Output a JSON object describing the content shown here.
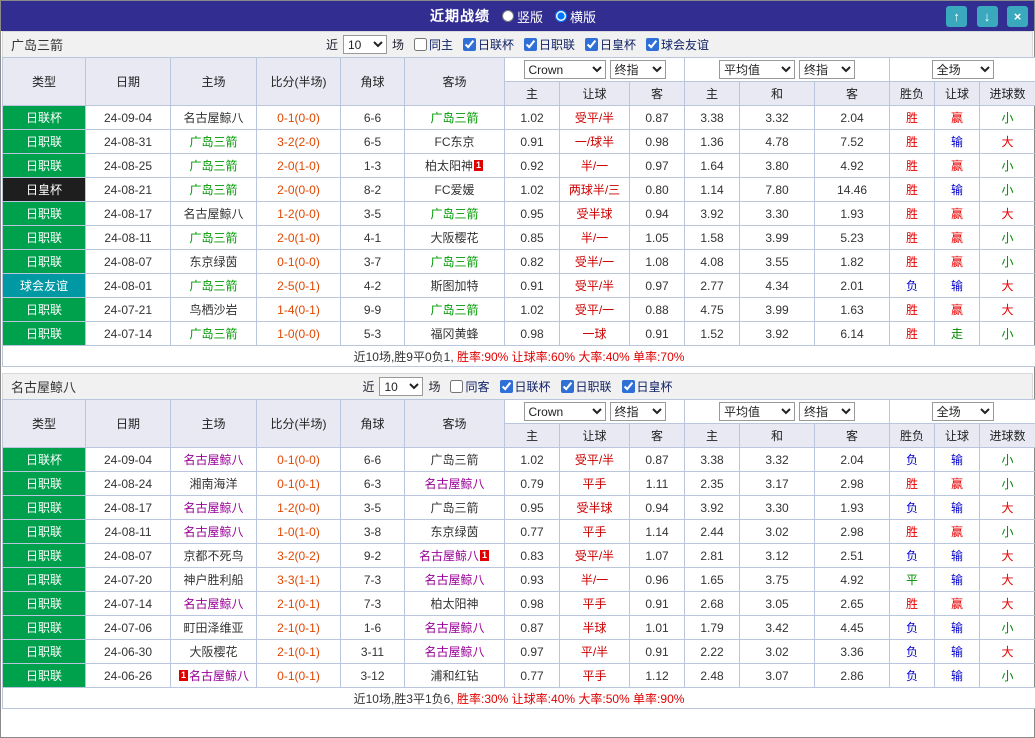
{
  "topbar": {
    "title": "近期战绩",
    "layouts": [
      {
        "label": "竖版",
        "selected": false
      },
      {
        "label": "横版",
        "selected": true
      }
    ],
    "up_icon": "↑",
    "down_icon": "↓",
    "close_icon": "×"
  },
  "filter_labels": {
    "near": "近",
    "count": "10",
    "unit": "场"
  },
  "odds_header": {
    "source": "Crown",
    "final1": "终指",
    "average": "平均值",
    "final2": "终指",
    "scope": "全场"
  },
  "columns": {
    "type": "类型",
    "date": "日期",
    "home": "主场",
    "score": "比分(半场)",
    "corner": "角球",
    "away": "客场",
    "o_home": "主",
    "o_handicap": "让球",
    "o_away": "客",
    "a_home": "主",
    "a_draw": "和",
    "a_away": "客",
    "r_wdl": "胜负",
    "r_handicap": "让球",
    "r_goals": "进球数"
  },
  "card_marker": "1",
  "colors": {
    "win_red": "#e80000",
    "lose_blue": "#0000cc",
    "draw_green": "#008a00",
    "team1_green": "#009900",
    "team2_purple": "#990099",
    "league_green": "#00a14d",
    "cup_dark": "#1e1e1e",
    "friendly_teal": "#0099a3",
    "topbar_indigo": "#322e91",
    "button_teal": "#3aa8bd"
  },
  "sections": [
    {
      "team": "广岛三箭",
      "same_filter": {
        "label": "同主",
        "checked": false
      },
      "league_filters": [
        {
          "label": "日联杯",
          "checked": true
        },
        {
          "label": "日职联",
          "checked": true
        },
        {
          "label": "日皇杯",
          "checked": true
        },
        {
          "label": "球会友谊",
          "checked": true
        }
      ],
      "rows": [
        {
          "lg": "日联杯",
          "lgc": "green",
          "date": "24-09-04",
          "home": "名古屋鲸八",
          "homec": "",
          "score": "0-1(0-0)",
          "corner": "6-6",
          "away": "广岛三箭",
          "awayc": "t1",
          "o": [
            "1.02",
            "受平/半",
            "0.87"
          ],
          "avg": [
            "3.38",
            "3.32",
            "2.04"
          ],
          "res": [
            [
              "胜",
              "w"
            ],
            [
              "赢",
              "w"
            ],
            [
              "小",
              "d"
            ]
          ]
        },
        {
          "lg": "日职联",
          "lgc": "green",
          "date": "24-08-31",
          "home": "广岛三箭",
          "homec": "t1",
          "score": "3-2(2-0)",
          "corner": "6-5",
          "away": "FC东京",
          "awayc": "",
          "o": [
            "0.91",
            "一/球半",
            "0.98"
          ],
          "avg": [
            "1.36",
            "4.78",
            "7.52"
          ],
          "res": [
            [
              "胜",
              "w"
            ],
            [
              "输",
              "l"
            ],
            [
              "大",
              "w"
            ]
          ]
        },
        {
          "lg": "日职联",
          "lgc": "green",
          "date": "24-08-25",
          "home": "广岛三箭",
          "homec": "t1",
          "score": "2-0(1-0)",
          "corner": "1-3",
          "away": "柏太阳神",
          "awayc": "",
          "awaycard": "post",
          "o": [
            "0.92",
            "半/一",
            "0.97"
          ],
          "avg": [
            "1.64",
            "3.80",
            "4.92"
          ],
          "res": [
            [
              "胜",
              "w"
            ],
            [
              "赢",
              "w"
            ],
            [
              "小",
              "d"
            ]
          ]
        },
        {
          "lg": "日皇杯",
          "lgc": "dark",
          "date": "24-08-21",
          "home": "广岛三箭",
          "homec": "t1",
          "score": "2-0(0-0)",
          "corner": "8-2",
          "away": "FC爱媛",
          "awayc": "",
          "o": [
            "1.02",
            "两球半/三",
            "0.80"
          ],
          "avg": [
            "1.14",
            "7.80",
            "14.46"
          ],
          "res": [
            [
              "胜",
              "w"
            ],
            [
              "输",
              "l"
            ],
            [
              "小",
              "d"
            ]
          ]
        },
        {
          "lg": "日职联",
          "lgc": "green",
          "date": "24-08-17",
          "home": "名古屋鲸八",
          "homec": "",
          "score": "1-2(0-0)",
          "corner": "3-5",
          "away": "广岛三箭",
          "awayc": "t1",
          "o": [
            "0.95",
            "受半球",
            "0.94"
          ],
          "avg": [
            "3.92",
            "3.30",
            "1.93"
          ],
          "res": [
            [
              "胜",
              "w"
            ],
            [
              "赢",
              "w"
            ],
            [
              "大",
              "w"
            ]
          ]
        },
        {
          "lg": "日职联",
          "lgc": "green",
          "date": "24-08-11",
          "home": "广岛三箭",
          "homec": "t1",
          "score": "2-0(1-0)",
          "corner": "4-1",
          "away": "大阪樱花",
          "awayc": "",
          "o": [
            "0.85",
            "半/一",
            "1.05"
          ],
          "avg": [
            "1.58",
            "3.99",
            "5.23"
          ],
          "res": [
            [
              "胜",
              "w"
            ],
            [
              "赢",
              "w"
            ],
            [
              "小",
              "d"
            ]
          ]
        },
        {
          "lg": "日职联",
          "lgc": "green",
          "date": "24-08-07",
          "home": "东京绿茵",
          "homec": "",
          "score": "0-1(0-0)",
          "corner": "3-7",
          "away": "广岛三箭",
          "awayc": "t1",
          "o": [
            "0.82",
            "受半/一",
            "1.08"
          ],
          "avg": [
            "4.08",
            "3.55",
            "1.82"
          ],
          "res": [
            [
              "胜",
              "w"
            ],
            [
              "赢",
              "w"
            ],
            [
              "小",
              "d"
            ]
          ]
        },
        {
          "lg": "球会友谊",
          "lgc": "teal",
          "date": "24-08-01",
          "home": "广岛三箭",
          "homec": "t1",
          "score": "2-5(0-1)",
          "corner": "4-2",
          "away": "斯图加特",
          "awayc": "",
          "o": [
            "0.91",
            "受平/半",
            "0.97"
          ],
          "avg": [
            "2.77",
            "4.34",
            "2.01"
          ],
          "res": [
            [
              "负",
              "l"
            ],
            [
              "输",
              "l"
            ],
            [
              "大",
              "w"
            ]
          ]
        },
        {
          "lg": "日职联",
          "lgc": "green",
          "date": "24-07-21",
          "home": "鸟栖沙岩",
          "homec": "",
          "score": "1-4(0-1)",
          "corner": "9-9",
          "away": "广岛三箭",
          "awayc": "t1",
          "o": [
            "1.02",
            "受平/一",
            "0.88"
          ],
          "avg": [
            "4.75",
            "3.99",
            "1.63"
          ],
          "res": [
            [
              "胜",
              "w"
            ],
            [
              "赢",
              "w"
            ],
            [
              "大",
              "w"
            ]
          ]
        },
        {
          "lg": "日职联",
          "lgc": "green",
          "date": "24-07-14",
          "home": "广岛三箭",
          "homec": "t1",
          "score": "1-0(0-0)",
          "corner": "5-3",
          "away": "福冈黄蜂",
          "awayc": "",
          "o": [
            "0.98",
            "一球",
            "0.91"
          ],
          "avg": [
            "1.52",
            "3.92",
            "6.14"
          ],
          "res": [
            [
              "胜",
              "w"
            ],
            [
              "走",
              "d"
            ],
            [
              "小",
              "d"
            ]
          ]
        }
      ],
      "summary_prefix": "近10场,胜9平0负1, ",
      "summary_stats": "胜率:90% 让球率:60% 大率:40% 单率:70%"
    },
    {
      "team": "名古屋鲸八",
      "same_filter": {
        "label": "同客",
        "checked": false
      },
      "league_filters": [
        {
          "label": "日联杯",
          "checked": true
        },
        {
          "label": "日职联",
          "checked": true
        },
        {
          "label": "日皇杯",
          "checked": true
        }
      ],
      "rows": [
        {
          "lg": "日联杯",
          "lgc": "green",
          "date": "24-09-04",
          "home": "名古屋鲸八",
          "homec": "t2",
          "score": "0-1(0-0)",
          "corner": "6-6",
          "away": "广岛三箭",
          "awayc": "",
          "o": [
            "1.02",
            "受平/半",
            "0.87"
          ],
          "avg": [
            "3.38",
            "3.32",
            "2.04"
          ],
          "res": [
            [
              "负",
              "l"
            ],
            [
              "输",
              "l"
            ],
            [
              "小",
              "d"
            ]
          ]
        },
        {
          "lg": "日职联",
          "lgc": "green",
          "date": "24-08-24",
          "home": "湘南海洋",
          "homec": "",
          "score": "0-1(0-1)",
          "corner": "6-3",
          "away": "名古屋鲸八",
          "awayc": "t2",
          "o": [
            "0.79",
            "平手",
            "1.11"
          ],
          "avg": [
            "2.35",
            "3.17",
            "2.98"
          ],
          "res": [
            [
              "胜",
              "w"
            ],
            [
              "赢",
              "w"
            ],
            [
              "小",
              "d"
            ]
          ]
        },
        {
          "lg": "日职联",
          "lgc": "green",
          "date": "24-08-17",
          "home": "名古屋鲸八",
          "homec": "t2",
          "score": "1-2(0-0)",
          "corner": "3-5",
          "away": "广岛三箭",
          "awayc": "",
          "o": [
            "0.95",
            "受半球",
            "0.94"
          ],
          "avg": [
            "3.92",
            "3.30",
            "1.93"
          ],
          "res": [
            [
              "负",
              "l"
            ],
            [
              "输",
              "l"
            ],
            [
              "大",
              "w"
            ]
          ]
        },
        {
          "lg": "日职联",
          "lgc": "green",
          "date": "24-08-11",
          "home": "名古屋鲸八",
          "homec": "t2",
          "score": "1-0(1-0)",
          "corner": "3-8",
          "away": "东京绿茵",
          "awayc": "",
          "o": [
            "0.77",
            "平手",
            "1.14"
          ],
          "avg": [
            "2.44",
            "3.02",
            "2.98"
          ],
          "res": [
            [
              "胜",
              "w"
            ],
            [
              "赢",
              "w"
            ],
            [
              "小",
              "d"
            ]
          ]
        },
        {
          "lg": "日职联",
          "lgc": "green",
          "date": "24-08-07",
          "home": "京都不死鸟",
          "homec": "",
          "score": "3-2(0-2)",
          "corner": "9-2",
          "away": "名古屋鲸八",
          "awayc": "t2",
          "awaycard": "post",
          "o": [
            "0.83",
            "受平/半",
            "1.07"
          ],
          "avg": [
            "2.81",
            "3.12",
            "2.51"
          ],
          "res": [
            [
              "负",
              "l"
            ],
            [
              "输",
              "l"
            ],
            [
              "大",
              "w"
            ]
          ]
        },
        {
          "lg": "日职联",
          "lgc": "green",
          "date": "24-07-20",
          "home": "神户胜利船",
          "homec": "",
          "score": "3-3(1-1)",
          "corner": "7-3",
          "away": "名古屋鲸八",
          "awayc": "t2",
          "o": [
            "0.93",
            "半/一",
            "0.96"
          ],
          "avg": [
            "1.65",
            "3.75",
            "4.92"
          ],
          "res": [
            [
              "平",
              "d"
            ],
            [
              "输",
              "l"
            ],
            [
              "大",
              "w"
            ]
          ]
        },
        {
          "lg": "日职联",
          "lgc": "green",
          "date": "24-07-14",
          "home": "名古屋鲸八",
          "homec": "t2",
          "score": "2-1(0-1)",
          "corner": "7-3",
          "away": "柏太阳神",
          "awayc": "",
          "o": [
            "0.98",
            "平手",
            "0.91"
          ],
          "avg": [
            "2.68",
            "3.05",
            "2.65"
          ],
          "res": [
            [
              "胜",
              "w"
            ],
            [
              "赢",
              "w"
            ],
            [
              "大",
              "w"
            ]
          ]
        },
        {
          "lg": "日职联",
          "lgc": "green",
          "date": "24-07-06",
          "home": "町田泽维亚",
          "homec": "",
          "score": "2-1(0-1)",
          "corner": "1-6",
          "away": "名古屋鲸八",
          "awayc": "t2",
          "o": [
            "0.87",
            "半球",
            "1.01"
          ],
          "avg": [
            "1.79",
            "3.42",
            "4.45"
          ],
          "res": [
            [
              "负",
              "l"
            ],
            [
              "输",
              "l"
            ],
            [
              "小",
              "d"
            ]
          ]
        },
        {
          "lg": "日职联",
          "lgc": "green",
          "date": "24-06-30",
          "home": "大阪樱花",
          "homec": "",
          "score": "2-1(0-1)",
          "corner": "3-11",
          "away": "名古屋鲸八",
          "awayc": "t2",
          "o": [
            "0.97",
            "平/半",
            "0.91"
          ],
          "avg": [
            "2.22",
            "3.02",
            "3.36"
          ],
          "res": [
            [
              "负",
              "l"
            ],
            [
              "输",
              "l"
            ],
            [
              "大",
              "w"
            ]
          ]
        },
        {
          "lg": "日职联",
          "lgc": "green",
          "date": "24-06-26",
          "home": "名古屋鲸八",
          "homec": "t2",
          "homecard": "pre",
          "score": "0-1(0-1)",
          "corner": "3-12",
          "away": "浦和红钻",
          "awayc": "",
          "o": [
            "0.77",
            "平手",
            "1.12"
          ],
          "avg": [
            "2.48",
            "3.07",
            "2.86"
          ],
          "res": [
            [
              "负",
              "l"
            ],
            [
              "输",
              "l"
            ],
            [
              "小",
              "d"
            ]
          ]
        }
      ],
      "summary_prefix": "近10场,胜3平1负6, ",
      "summary_stats": "胜率:30% 让球率:40% 大率:50% 单率:90%"
    }
  ]
}
